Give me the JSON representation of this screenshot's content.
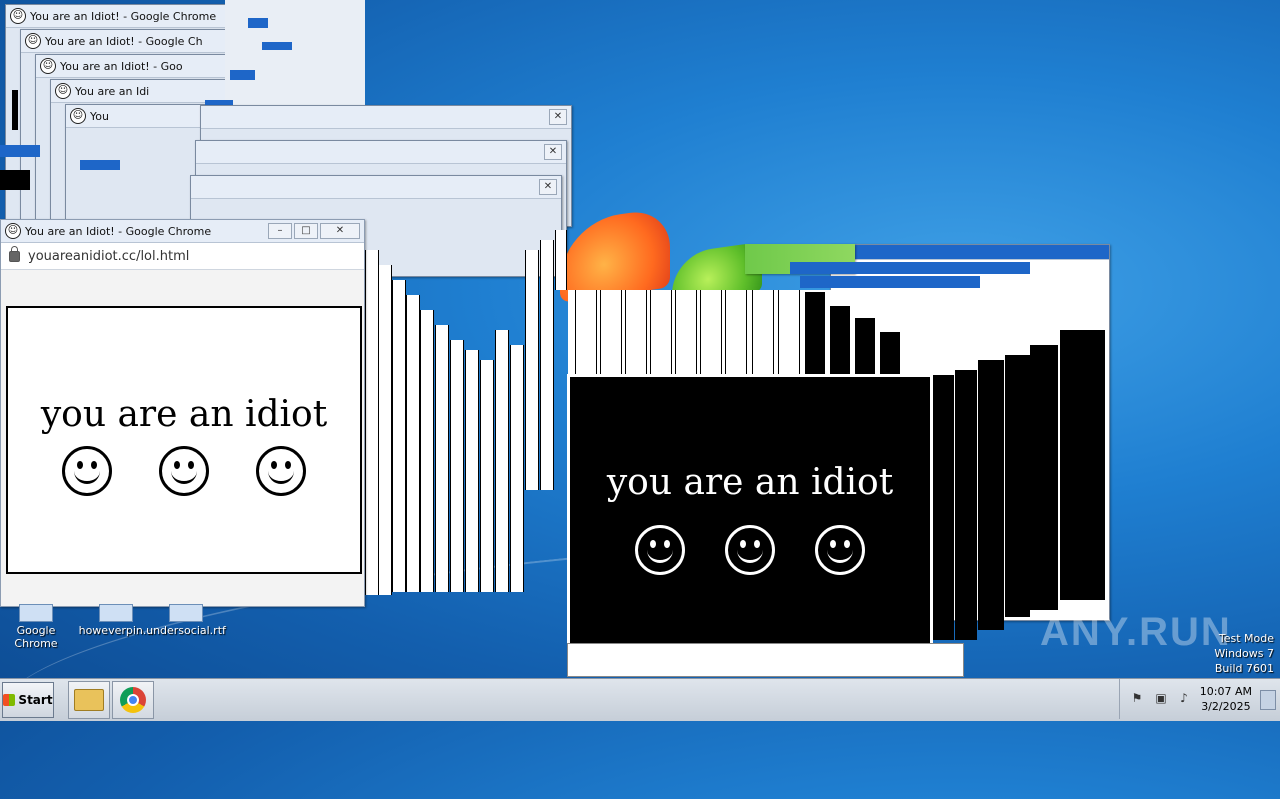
{
  "windows": {
    "title": "You are an Idiot! - Google Chrome",
    "title_trunc_1": "You are an Idiot! - Google Ch",
    "title_trunc_2": "You are an Idiot! - Goo",
    "title_trunc_3": "You are an Idi",
    "title_trunc_4": "You",
    "url": "youareanidiot.cc/lol.html",
    "message": "you are an idiot",
    "minimize_glyph": "–",
    "maximize_glyph": "□",
    "close_glyph": "✕",
    "smile_glyph": "☺"
  },
  "desktop": {
    "icons": [
      {
        "label": "Google Chrome"
      },
      {
        "label": "howeverpin..."
      },
      {
        "label": "undersocial.rtf"
      }
    ]
  },
  "taskbar": {
    "start_label": "Start",
    "time": "10:07 AM",
    "date": "3/2/2025"
  },
  "watermark": {
    "line1": "Test Mode",
    "line2": "Windows 7",
    "line3": "Build 7601",
    "brand": "ANY.RUN"
  }
}
